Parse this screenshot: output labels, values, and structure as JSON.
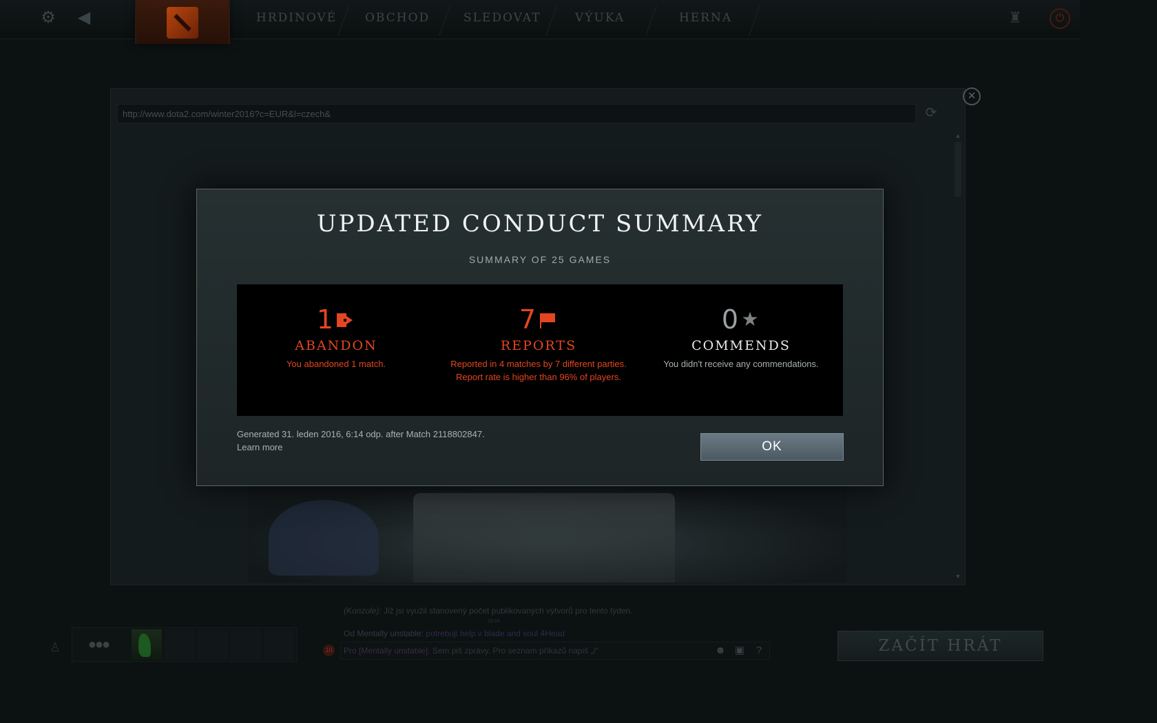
{
  "topbar": {
    "nav": [
      "HRDINOVÉ",
      "OBCHOD",
      "SLEDOVAT",
      "VÝUKA",
      "HERNA"
    ]
  },
  "browser": {
    "url": "http://www.dota2.com/winter2016?c=EUR&l=czech&"
  },
  "modal": {
    "title": "UPDATED CONDUCT SUMMARY",
    "subtitle": "SUMMARY OF 25 GAMES",
    "stats": [
      {
        "value": "1",
        "label": "ABANDON",
        "desc": [
          "You abandoned 1 match."
        ],
        "icon": "abandon-icon",
        "color": "#e4461f"
      },
      {
        "value": "7",
        "label": "REPORTS",
        "desc": [
          "Reported in 4 matches by 7 different parties.",
          "Report rate is higher than 96% of players."
        ],
        "icon": "flag-icon",
        "color": "#e4461f"
      },
      {
        "value": "0",
        "label": "COMMENDS",
        "desc": [
          "You didn't receive any commendations."
        ],
        "icon": "star-icon",
        "color": "#9aa2a3"
      }
    ],
    "generated": "Generated 31. leden 2016, 6:14 odp. after Match 2118802847.",
    "learn_more": "Learn more",
    "ok": "OK"
  },
  "chat": {
    "console_prefix": "(Konzole):",
    "console_msg": " Již jsi využil stanovený počet publikovaných výtvorů pro tento týden.",
    "time": "18:04",
    "from_prefix": "Od ",
    "from_user": "Mentally unstable:",
    "from_msg": " potrebuji help v blade and soul 4Head",
    "badge": "10",
    "input_to": "Pro [Mentally unstable]:",
    "input_placeholder": " Sem piš zprávy. Pro seznam příkazů napiš „/“"
  },
  "play_button": "ZAČÍT HRÁT",
  "colors": {
    "accent": "#e4461f",
    "ok_button": "#5b6a73"
  }
}
